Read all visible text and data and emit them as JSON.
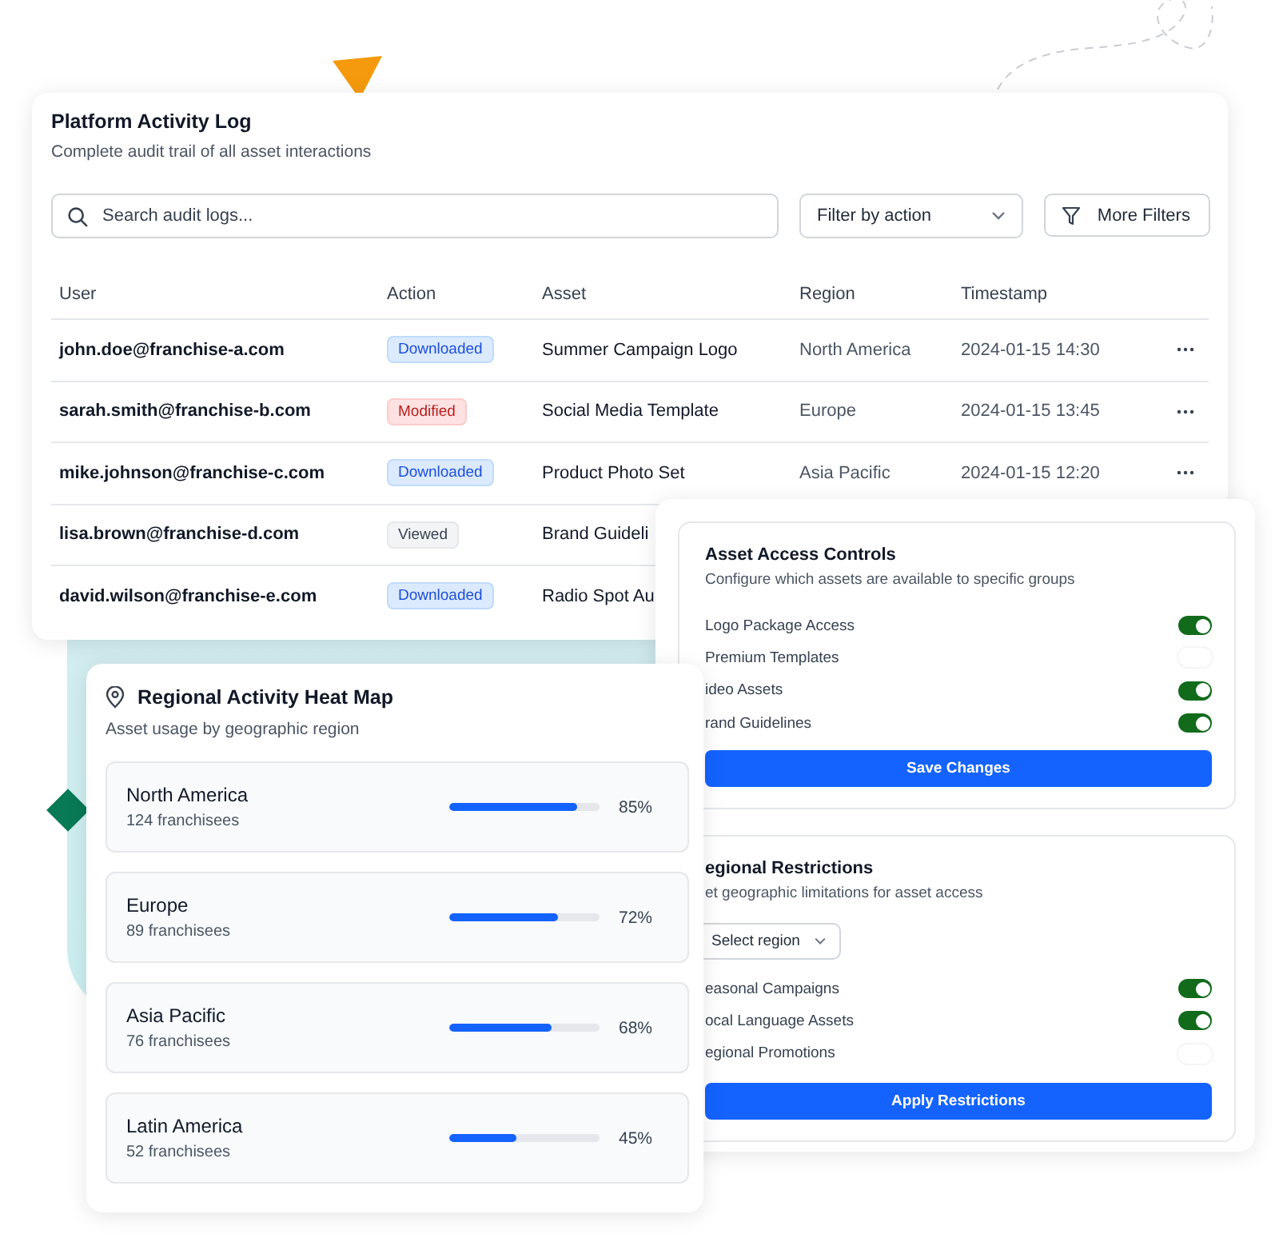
{
  "activity_log": {
    "title": "Platform Activity Log",
    "subtitle": "Complete audit trail of all asset interactions",
    "search": {
      "placeholder": "Search audit logs..."
    },
    "filter": {
      "label": "Filter by action"
    },
    "more_filters": "More Filters",
    "columns": [
      "User",
      "Action",
      "Asset",
      "Region",
      "Timestamp"
    ],
    "rows": [
      {
        "user": "john.doe@franchise-a.com",
        "action": {
          "label": "Downloaded",
          "kind": "downloaded"
        },
        "asset": "Summer Campaign Logo",
        "region": "North America",
        "timestamp": "2024-01-15 14:30",
        "menu": true
      },
      {
        "user": "sarah.smith@franchise-b.com",
        "action": {
          "label": "Modified",
          "kind": "modified"
        },
        "asset": "Social Media Template",
        "region": "Europe",
        "timestamp": "2024-01-15 13:45",
        "menu": true
      },
      {
        "user": "mike.johnson@franchise-c.com",
        "action": {
          "label": "Downloaded",
          "kind": "downloaded"
        },
        "asset": "Product Photo Set",
        "region": "Asia Pacific",
        "timestamp": "2024-01-15 12:20",
        "menu": true
      },
      {
        "user": "lisa.brown@franchise-d.com",
        "action": {
          "label": "Viewed",
          "kind": "viewed"
        },
        "asset": "Brand Guideli"
      },
      {
        "user": "david.wilson@franchise-e.com",
        "action": {
          "label": "Downloaded",
          "kind": "downloaded"
        },
        "asset": "Radio Spot Au"
      }
    ]
  },
  "access_controls": {
    "title": "Asset Access Controls",
    "subtitle": "Configure which assets are available to specific groups",
    "toggles": [
      {
        "label": "Logo Package Access",
        "on": true
      },
      {
        "label": "Premium Templates",
        "on": false
      },
      {
        "label": "ideo Assets",
        "on": true
      },
      {
        "label": "rand Guidelines",
        "on": true
      }
    ],
    "button": "Save Changes"
  },
  "regional_restrictions": {
    "title": "egional Restrictions",
    "subtitle": "et geographic limitations for asset access",
    "select": {
      "label": "Select region"
    },
    "toggles": [
      {
        "label": "easonal Campaigns",
        "on": true
      },
      {
        "label": "ocal Language Assets",
        "on": true
      },
      {
        "label": "egional Promotions",
        "on": false
      }
    ],
    "button": "Apply Restrictions"
  },
  "heat_map": {
    "title": "Regional Activity Heat Map",
    "subtitle": "Asset usage by geographic region",
    "regions": [
      {
        "name": "North America",
        "count": "124 franchisees",
        "level": 0.85,
        "reading": "85%"
      },
      {
        "name": "Europe",
        "count": "89 franchisees",
        "level": 0.72,
        "reading": "72%"
      },
      {
        "name": "Asia Pacific",
        "count": "76 franchisees",
        "level": 0.68,
        "reading": "68%"
      },
      {
        "name": "Latin America",
        "count": "52 franchisees",
        "level": 0.45,
        "reading": "45%"
      }
    ]
  }
}
